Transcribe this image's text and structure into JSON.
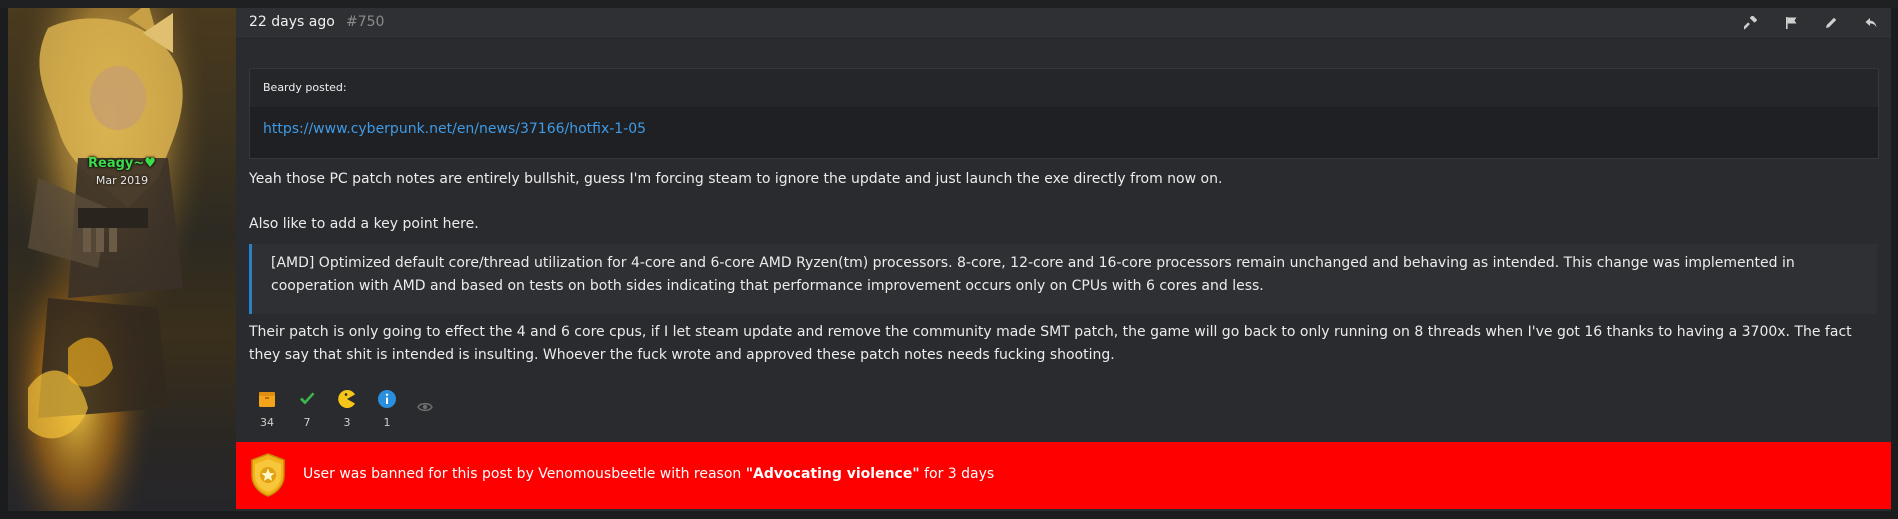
{
  "post": {
    "timestamp": "22 days ago",
    "post_number": "#750"
  },
  "author": {
    "username": "Reagy~♥",
    "join_date": "Mar 2019"
  },
  "quote": {
    "author_line": "Beardy  posted:",
    "link": "https://www.cyberpunk.net/en/news/37166/hotfix-1-05"
  },
  "content": {
    "paragraph1": "Yeah those PC patch notes are entirely bullshit, guess I'm forcing steam to ignore the update and just launch the exe directly from now on.",
    "paragraph2": "Also like to add a key point here.",
    "blockquote": "[AMD] Optimized default core/thread utilization for 4-core and 6-core AMD Ryzen(tm) processors. 8-core, 12-core and 16-core processors remain unchanged and behaving as intended. This change was implemented in cooperation with AMD and based on tests on both sides indicating that performance improvement occurs only on CPUs with 6 cores and less.",
    "paragraph3": "Their patch is only going to effect the 4 and 6 core cpus, if I let steam update and remove the community made SMT patch, the game will go back to only running on 8 threads when I've got 16 thanks to having a 3700x. The fact they say that shit is intended is insulting. Whoever the fuck wrote and approved these patch notes needs fucking shooting."
  },
  "actions": [
    {
      "icon": "gavel-icon"
    },
    {
      "icon": "flag-icon"
    },
    {
      "icon": "pencil-icon"
    },
    {
      "icon": "reply-icon"
    }
  ],
  "reactions": [
    {
      "icon": "box-icon",
      "count": "34",
      "color": "#f5a31a"
    },
    {
      "icon": "checkmark-icon",
      "count": "7",
      "color": "#3cb64a"
    },
    {
      "icon": "pacman-icon",
      "count": "3",
      "color": "#f5c518"
    },
    {
      "icon": "info-icon",
      "count": "1",
      "color": "#2b8fe0"
    }
  ],
  "ban": {
    "prefix": "User was banned for this post by Venomousbeetle with reason ",
    "reason": "\"Advocating violence\"",
    "suffix": " for 3 days",
    "color": "#ff0000"
  },
  "colors": {
    "username": "#3ddc4d",
    "link": "#3f9be6",
    "blockquote_border": "#2b7fc4"
  }
}
